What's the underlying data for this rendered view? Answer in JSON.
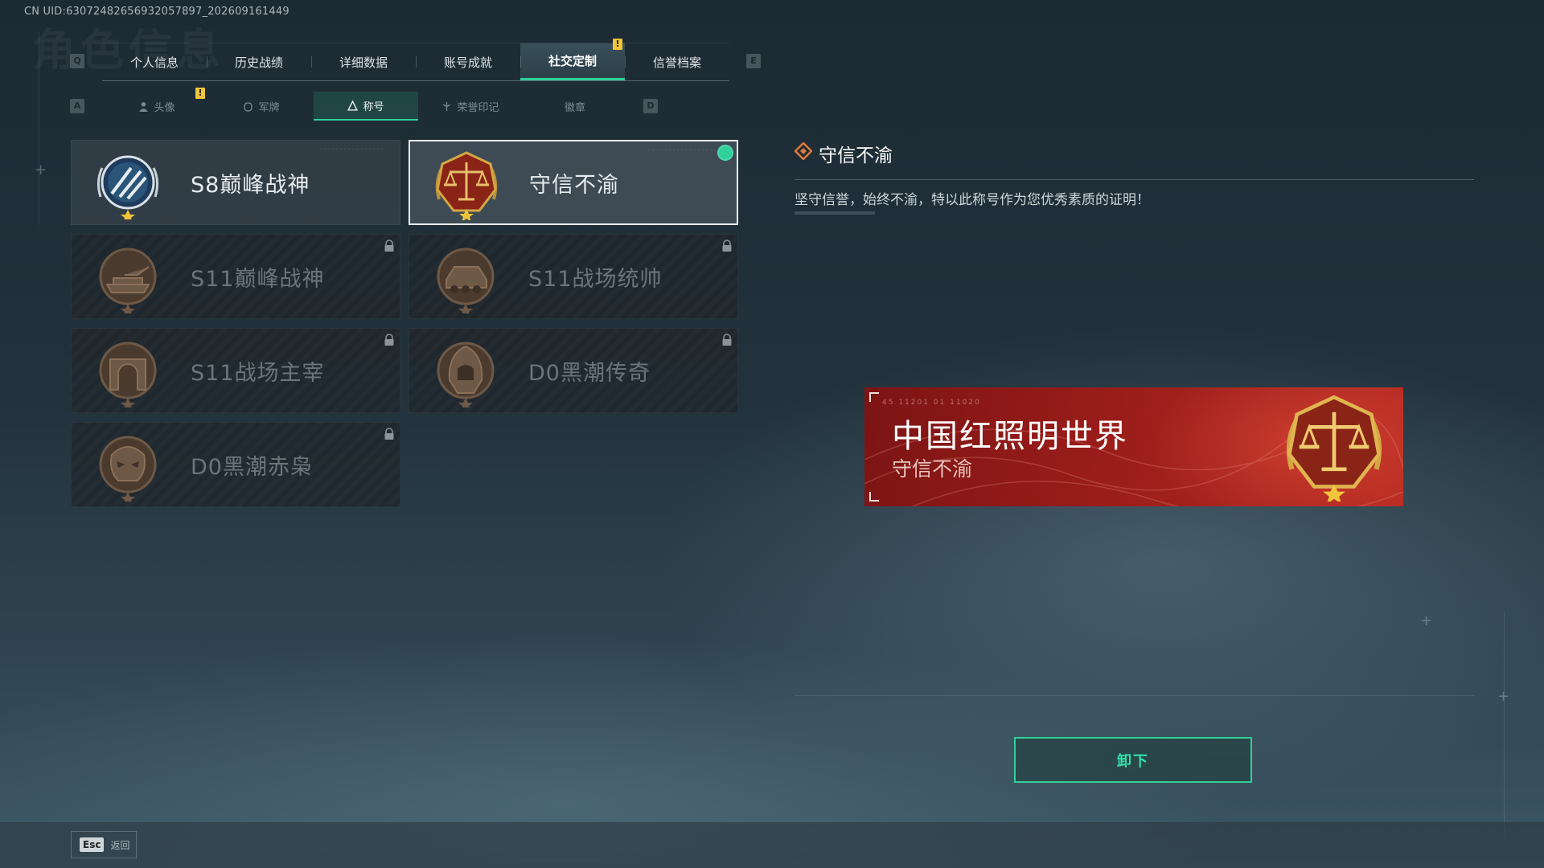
{
  "uid_text": "CN UID:63072482656932057897_202609161449",
  "ghost_title": "角色信息",
  "keys": {
    "prev_tab": "Q",
    "next_tab": "E",
    "prev_sub": "A",
    "next_sub": "D"
  },
  "top_tabs": [
    {
      "label": "个人信息"
    },
    {
      "label": "历史战绩"
    },
    {
      "label": "详细数据"
    },
    {
      "label": "账号成就"
    },
    {
      "label": "社交定制",
      "active": true,
      "badge": "!"
    },
    {
      "label": "信誉档案"
    }
  ],
  "sub_tabs": [
    {
      "label": "头像",
      "icon": "person-icon",
      "badge": "!"
    },
    {
      "label": "军牌",
      "icon": "dogtag-icon"
    },
    {
      "label": "称号",
      "icon": "triangle-icon",
      "active": true
    },
    {
      "label": "荣誉印记",
      "icon": "honor-icon"
    },
    {
      "label": "徽章",
      "icon": ""
    }
  ],
  "titles": [
    {
      "label": "S8巅峰战神",
      "state": "owned",
      "emblem": "s8-emblem"
    },
    {
      "label": "守信不渝",
      "state": "selected-equipped",
      "emblem": "scales-emblem"
    },
    {
      "label": "S11巅峰战神",
      "state": "locked",
      "emblem": "tank-emblem"
    },
    {
      "label": "S11战场统帅",
      "state": "locked",
      "emblem": "apc-emblem"
    },
    {
      "label": "S11战场主宰",
      "state": "locked",
      "emblem": "arch-emblem"
    },
    {
      "label": "D0黑潮传奇",
      "state": "locked",
      "emblem": "hooded-emblem"
    },
    {
      "label": "D0黑潮赤枭",
      "state": "locked",
      "emblem": "skull-emblem"
    }
  ],
  "detail": {
    "name": "守信不渝",
    "description": "坚守信誉，始终不渝，特以此称号作为您优秀素质的证明！"
  },
  "banner": {
    "main": "中国红照明世界",
    "sub": "守信不渝",
    "code": "45 11201  01 11020"
  },
  "action_button": "卸下",
  "footer": {
    "esc_key": "Esc",
    "esc_label": "返回"
  },
  "colors": {
    "accent": "#2fd09a",
    "badge": "#f0c53a",
    "banner_red": "#9a1d1a"
  }
}
